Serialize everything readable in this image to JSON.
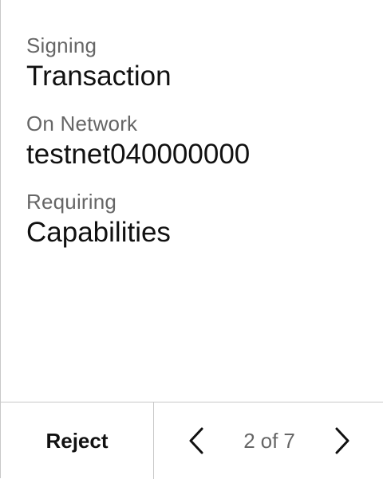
{
  "details": [
    {
      "label": "Signing",
      "value": "Transaction"
    },
    {
      "label": "On Network",
      "value": "testnet040000000"
    },
    {
      "label": "Requiring",
      "value": "Capabilities"
    }
  ],
  "footer": {
    "reject_label": "Reject",
    "page": {
      "current": "2",
      "separator": "of",
      "total": "7"
    },
    "prev_icon": "chevron-left-icon",
    "next_icon": "chevron-right-icon"
  },
  "colors": {
    "label": "#666666",
    "value": "#111111",
    "border": "#c8c8c8"
  }
}
